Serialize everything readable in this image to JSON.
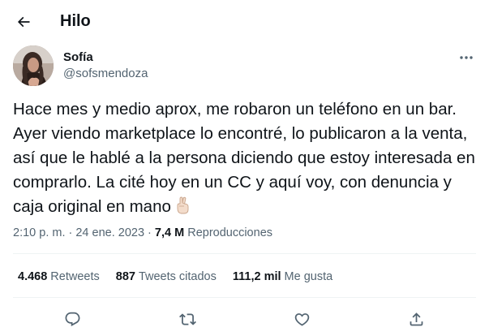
{
  "header": {
    "title": "Hilo"
  },
  "author": {
    "name": "Sofía",
    "handle": "@sofsmendoza"
  },
  "tweet": {
    "text": "Hace mes y medio aprox, me robaron un teléfono en un bar. Ayer viendo marketplace lo encontré, lo publicaron a la venta, así que le hablé a la persona diciendo que estoy interesada en comprarlo. La cité hoy en un CC y aquí voy, con denuncia y caja original en mano",
    "emoji": "crossed-fingers"
  },
  "meta": {
    "timestamp": "2:10 p. m. · 24 ene. 2023 · ",
    "views_count": "7,4 M",
    "views_label": "Reproducciones"
  },
  "stats": {
    "retweets": {
      "count": "4.468",
      "label": "Retweets"
    },
    "quotes": {
      "count": "887",
      "label": "Tweets citados"
    },
    "likes": {
      "count": "111,2 mil",
      "label": "Me gusta"
    }
  },
  "colors": {
    "text": "#0f1419",
    "secondary": "#536471",
    "divider": "#eff3f4",
    "icon": "#536471"
  },
  "icons": [
    "back-arrow-icon",
    "more-options-icon",
    "reply-icon",
    "retweet-icon",
    "like-icon",
    "share-icon"
  ]
}
